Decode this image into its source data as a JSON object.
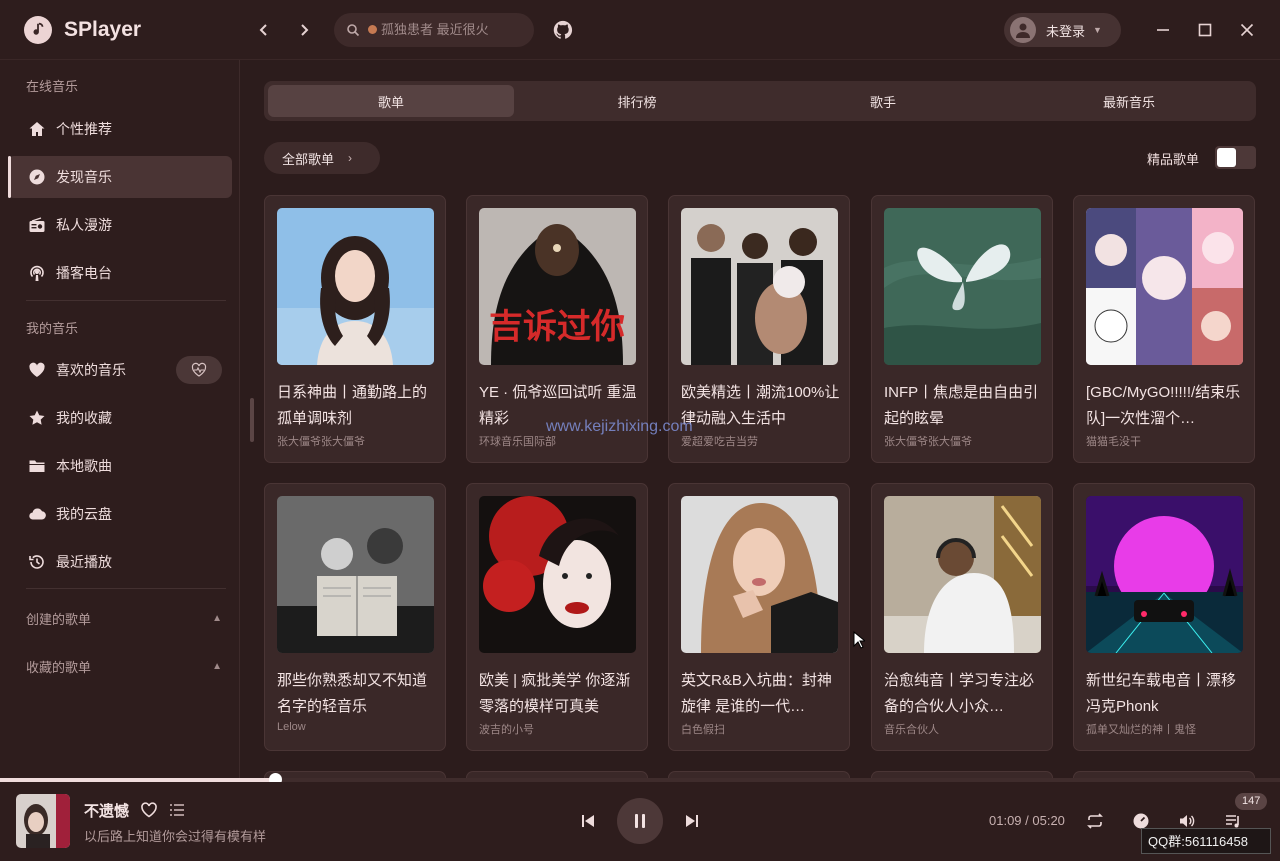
{
  "app": {
    "name": "SPlayer"
  },
  "search": {
    "placeholder": "孤独患者 最近很火"
  },
  "user": {
    "label": "未登录"
  },
  "sidebar": {
    "online_title": "在线音乐",
    "online_items": [
      {
        "label": "个性推荐",
        "icon": "home-icon"
      },
      {
        "label": "发现音乐",
        "icon": "compass-icon",
        "active": true
      },
      {
        "label": "私人漫游",
        "icon": "radio-icon"
      },
      {
        "label": "播客电台",
        "icon": "podcast-icon"
      }
    ],
    "mine_title": "我的音乐",
    "mine_items": [
      {
        "label": "喜欢的音乐",
        "icon": "heart-icon"
      },
      {
        "label": "我的收藏",
        "icon": "star-icon"
      },
      {
        "label": "本地歌曲",
        "icon": "folder-icon"
      },
      {
        "label": "我的云盘",
        "icon": "cloud-icon"
      },
      {
        "label": "最近播放",
        "icon": "history-icon"
      }
    ],
    "created_title": "创建的歌单",
    "collected_title": "收藏的歌单"
  },
  "tabs": [
    "歌单",
    "排行榜",
    "歌手",
    "最新音乐"
  ],
  "filter": {
    "all_label": "全部歌单",
    "premium_label": "精品歌单",
    "premium_on": false
  },
  "playlists": [
    {
      "title": "日系神曲丨通勤路上的孤单调味剂",
      "author": "张大僵爷张大僵爷"
    },
    {
      "title": "YE · 侃爷巡回试听 重温精彩",
      "author": "环球音乐国际部"
    },
    {
      "title": "欧美精选丨潮流100%让律动融入生活中",
      "author": "爱超爱吃吉当劳"
    },
    {
      "title": "INFP丨焦虑是由自由引起的眩晕",
      "author": "张大僵爷张大僵爷"
    },
    {
      "title": "[GBC/MyGO!!!!!/结束乐队]一次性溜个…",
      "author": "猫猫毛没干"
    },
    {
      "title": "那些你熟悉却又不知道名字的轻音乐",
      "author": "Lelow"
    },
    {
      "title": "欧美 | 疯批美学 你逐渐零落的模样可真美",
      "author": "波吉的小号"
    },
    {
      "title": "英文R&B入坑曲：封神旋律 是谁的一代…",
      "author": "白色假扫"
    },
    {
      "title": "治愈纯音丨学习专注必备的合伙人小众…",
      "author": "音乐合伙人"
    },
    {
      "title": "新世纪车载电音丨漂移冯克Phonk",
      "author": "孤单又灿烂的神丨鬼怪"
    }
  ],
  "watermark": "www.kejizhixing.com",
  "player": {
    "title": "不遗憾",
    "subtitle": "以后路上知道你会过得有模有样",
    "current_time": "01:09",
    "total_time": "05:20",
    "time_text": "01:09 / 05:20",
    "progress": 0.215,
    "queue_count": "147"
  },
  "overlay": {
    "qq": "QQ群:561116458"
  },
  "colors": {
    "background": "#2c1c1c",
    "sidebar": "#2e1d1d",
    "card": "#3a2828",
    "accent": "#f0dcdc"
  }
}
